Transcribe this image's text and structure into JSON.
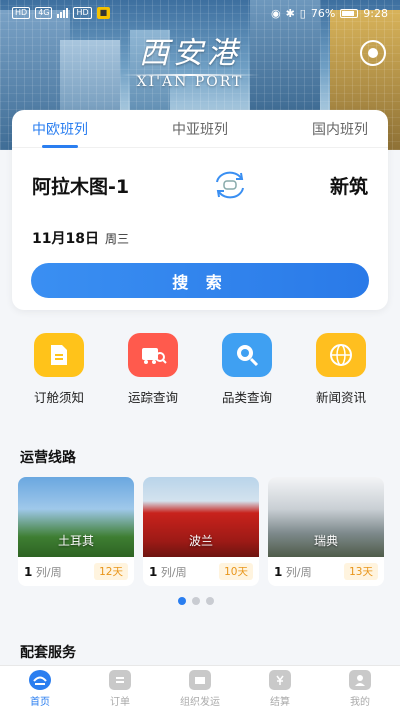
{
  "status_bar": {
    "left_chips": [
      "HD",
      "4G",
      "HD"
    ],
    "battery": "76%",
    "time": "9:28"
  },
  "logo": {
    "cn": "西安港",
    "en": "XI'AN PORT"
  },
  "tabs": [
    {
      "label": "中欧班列",
      "active": true
    },
    {
      "label": "中亚班列",
      "active": false
    },
    {
      "label": "国内班列",
      "active": false
    }
  ],
  "route": {
    "from": "阿拉木图-1",
    "to": "新筑"
  },
  "date": {
    "day": "11月18日",
    "weekday": "周三"
  },
  "search_button": "搜 索",
  "quick_links": [
    {
      "label": "订舱须知",
      "icon": "document-icon",
      "color": "#ffc31a"
    },
    {
      "label": "运踪查询",
      "icon": "train-search-icon",
      "color": "#ff5a4d"
    },
    {
      "label": "品类查询",
      "icon": "category-search-icon",
      "color": "#3fa0f2"
    },
    {
      "label": "新闻资讯",
      "icon": "news-globe-icon",
      "color": "#ffbf1f"
    }
  ],
  "routes_section_title": "运营线路",
  "routes": [
    {
      "name": "土耳其",
      "freq_num": "1",
      "freq_unit": "列/周",
      "days": "12天"
    },
    {
      "name": "波兰",
      "freq_num": "1",
      "freq_unit": "列/周",
      "days": "10天"
    },
    {
      "name": "瑞典",
      "freq_num": "1",
      "freq_unit": "列/周",
      "days": "13天"
    }
  ],
  "services_section_title": "配套服务",
  "bottom_nav": [
    {
      "label": "首页",
      "icon": "home-icon",
      "active": true
    },
    {
      "label": "订单",
      "icon": "order-icon",
      "active": false
    },
    {
      "label": "组织发运",
      "icon": "shipping-icon",
      "active": false
    },
    {
      "label": "结算",
      "icon": "settlement-icon",
      "active": false
    },
    {
      "label": "我的",
      "icon": "profile-icon",
      "active": false
    }
  ]
}
